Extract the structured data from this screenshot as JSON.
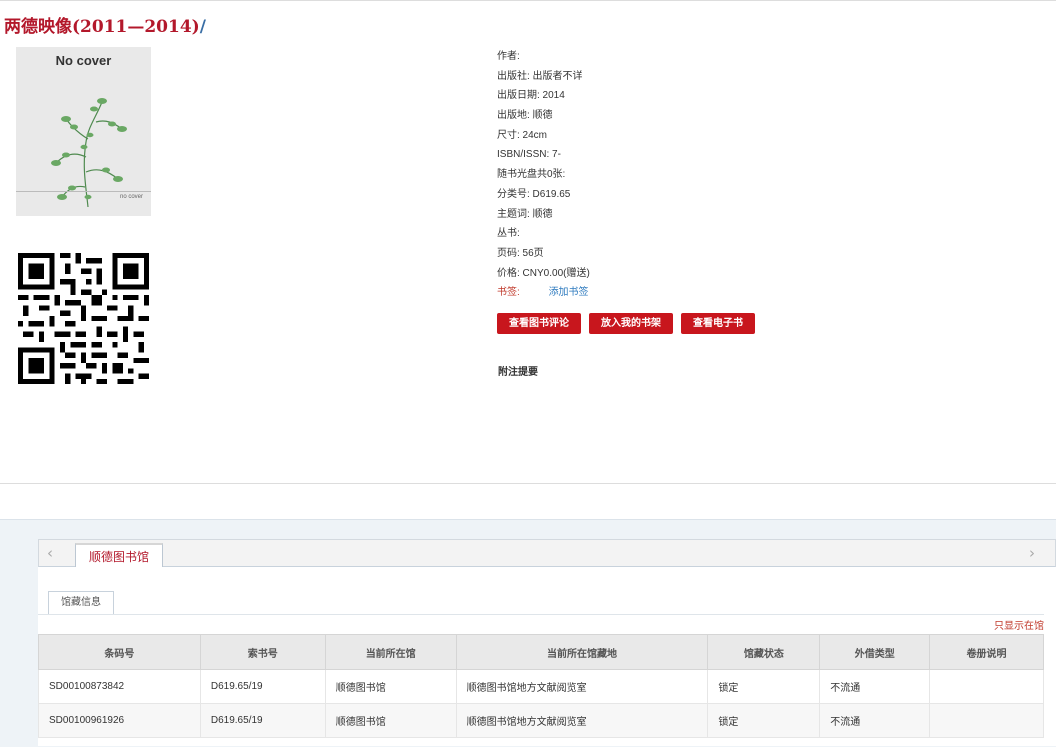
{
  "title": "两德映像(2011—2014)",
  "title_slash": "/",
  "cover": {
    "label_top": "No cover",
    "label_bottom": "no cover"
  },
  "meta": [
    "作者:",
    "出版社: 出版者不详",
    "出版日期: 2014",
    "出版地: 顺德",
    "尺寸: 24cm",
    "ISBN/ISSN: 7-",
    "随书光盘共0张:",
    "分类号: D619.65",
    "主题词: 顺德",
    "丛书:",
    "页码: 56页",
    "价格: CNY0.00(赠送)"
  ],
  "tags": {
    "label": "书签:",
    "add": "添加书签"
  },
  "buttons": {
    "review": "查看图书评论",
    "shelf": "放入我的书架",
    "ebook": "查看电子书"
  },
  "note_title": "附注提要",
  "library_tab": "顺德图书馆",
  "sub_tab": "馆藏信息",
  "only_in_library": "只显示在馆",
  "holdings": {
    "headers": [
      "条码号",
      "索书号",
      "当前所在馆",
      "当前所在馆藏地",
      "馆藏状态",
      "外借类型",
      "卷册说明"
    ],
    "rows": [
      [
        "SD00100873842",
        "D619.65/19",
        "顺德图书馆",
        "顺德图书馆地方文献阅览室",
        "锁定",
        "不流通",
        ""
      ],
      [
        "SD00100961926",
        "D619.65/19",
        "顺德图书馆",
        "顺德图书馆地方文献阅览室",
        "锁定",
        "不流通",
        ""
      ]
    ]
  }
}
